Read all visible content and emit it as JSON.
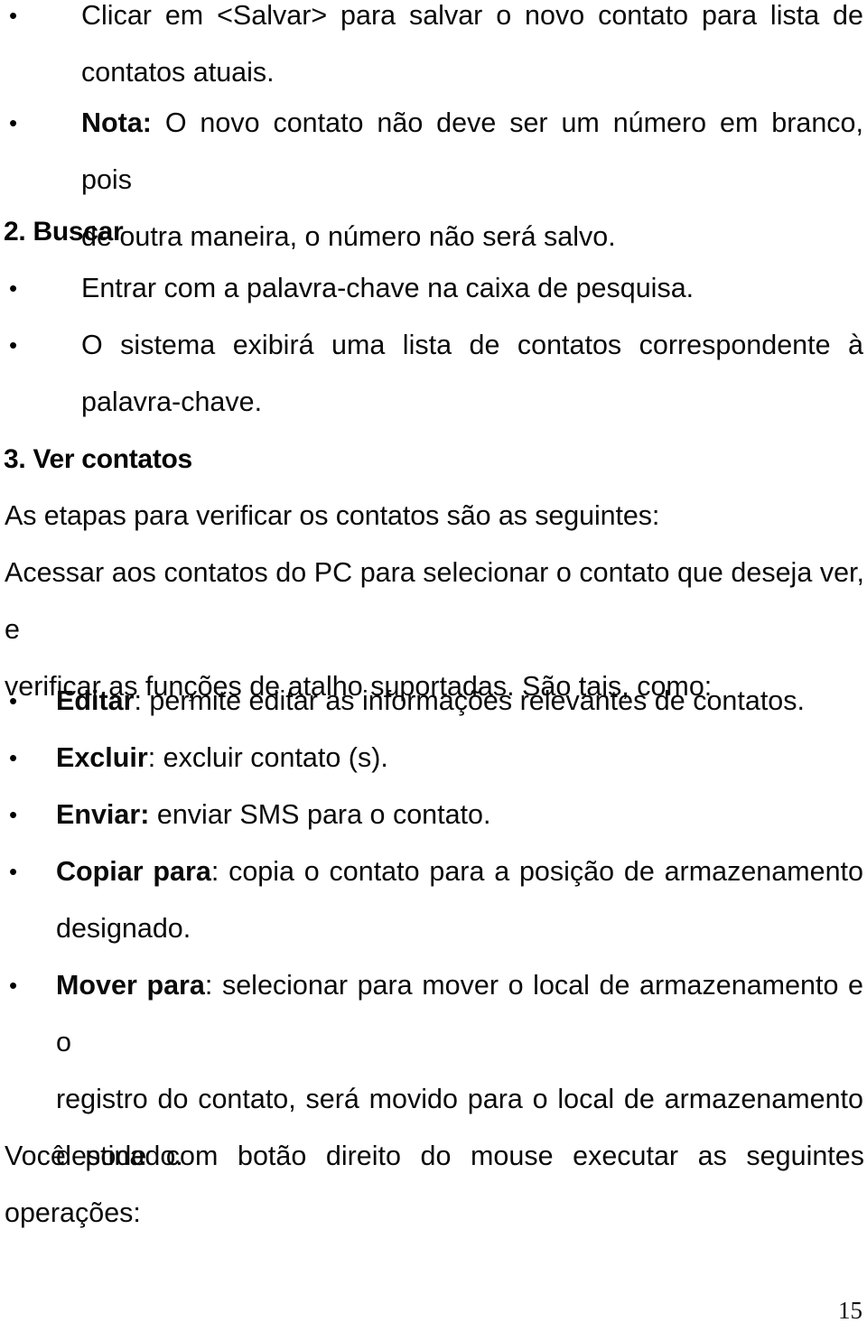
{
  "document": {
    "language": "pt-BR",
    "page_number": "15",
    "background_color": "#ffffff",
    "text_color": "#0a0a0a"
  },
  "sections": {
    "section1_tail": {
      "bullets": [
        {
          "marker": "•",
          "text": "Clicar em <Salvar> para salvar o novo contato para lista de contatos atuais.",
          "line1": "Clicar em <Salvar> para salvar o novo contato para lista de",
          "line2": "contatos atuais."
        },
        {
          "marker": "•",
          "bold_lead": "Nota:",
          "text": "Nota: O novo contato não deve ser um número em branco, pois de outra maneira, o número não será salvo.",
          "line1_rest": " O novo contato não deve ser um número em branco, pois",
          "line2": "de outra maneira, o número não será salvo."
        }
      ]
    },
    "section2": {
      "heading": "2. Buscar",
      "bullets": [
        {
          "marker": "•",
          "text": "Entrar com a palavra-chave na caixa de pesquisa."
        },
        {
          "marker": "•",
          "text": "O sistema exibirá uma lista de contatos correspondente à palavra-chave.",
          "line1": "O sistema exibirá uma lista de contatos correspondente à",
          "line2": "palavra-chave."
        }
      ]
    },
    "section3": {
      "heading": "3. Ver contatos",
      "intro": "As etapas para verificar os contatos são as seguintes:",
      "body": {
        "text": "Acessar aos contatos do PC para selecionar o contato que deseja ver, e verificar as funções de atalho suportadas. São tais, como:",
        "line1": "Acessar aos contatos do PC para selecionar o contato que deseja ver, e",
        "line2": "verificar as funções de atalho suportadas. São tais, como:"
      },
      "bullets": [
        {
          "marker": "•",
          "bold_lead": "Editar",
          "rest": ": permite editar as informações relevantes de contatos.",
          "text": "Editar: permite editar as informações relevantes de contatos."
        },
        {
          "marker": "•",
          "bold_lead": "Excluir",
          "rest": ": excluir contato (s).",
          "text": "Excluir: excluir contato (s)."
        },
        {
          "marker": "•",
          "bold_lead": "Enviar:",
          "rest": " enviar SMS para o contato.",
          "text": "Enviar: enviar SMS para o contato."
        },
        {
          "marker": "•",
          "bold_lead": "Copiar para",
          "rest": ": copia o contato para a posição de armazenamento",
          "line2": "designado.",
          "text": "Copiar para: copia o contato para a posição de armazenamento designado."
        },
        {
          "marker": "•",
          "bold_lead": "Mover para",
          "rest": ": selecionar para mover o local de armazenamento e o",
          "line2": "registro do contato, será movido para o local de armazenamento",
          "line3": "destinado.",
          "text": "Mover para: selecionar para mover o local de armazenamento e o registro do contato, será movido para o local de armazenamento destinado."
        }
      ],
      "closing": {
        "text": "Você pode com botão direito do mouse executar as seguintes operações:",
        "line1": "Você pode com botão direito do mouse executar as seguintes",
        "line2": "operações:"
      }
    }
  }
}
